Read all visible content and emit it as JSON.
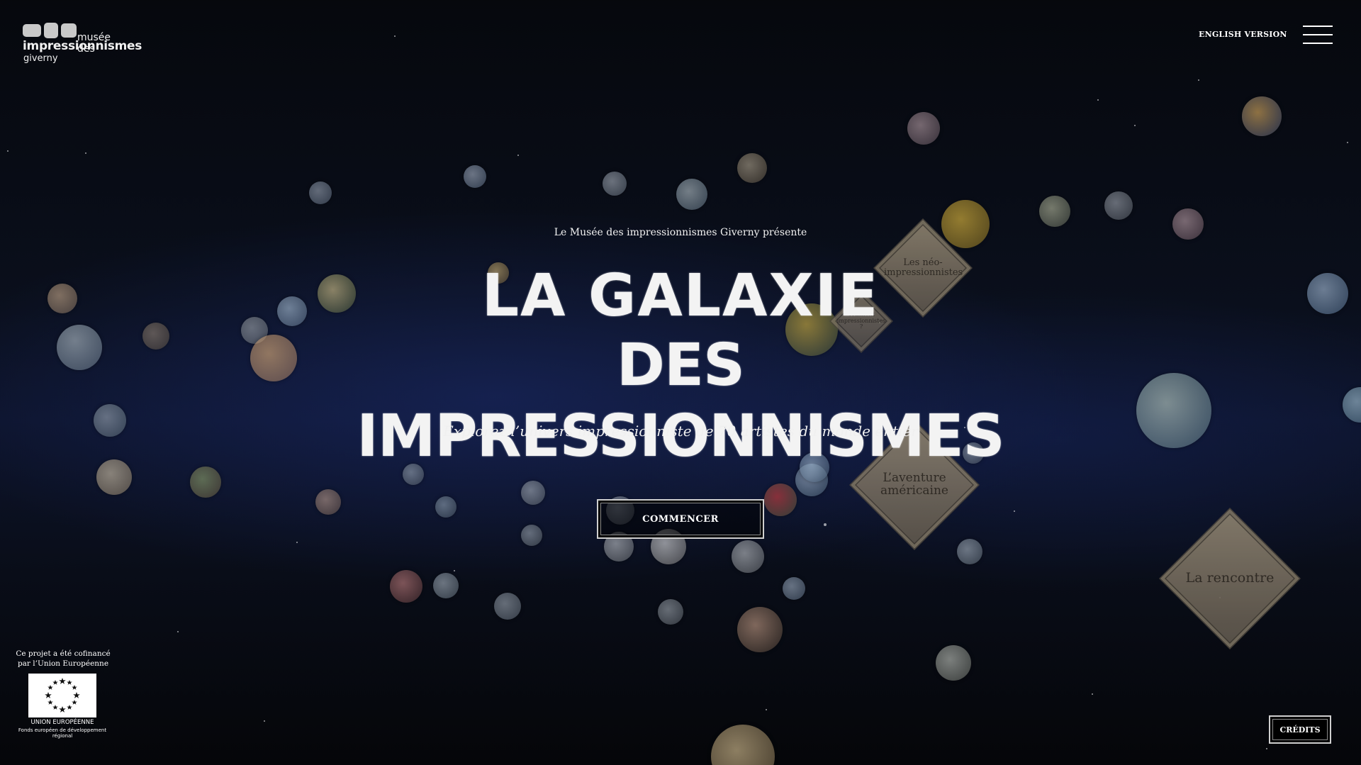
{
  "header": {
    "logo": {
      "line1": "musée des",
      "line2": "impressionnismes",
      "line3": "giverny"
    },
    "language_link": "ENGLISH VERSION",
    "menu_icon": "hamburger-menu-icon"
  },
  "hero": {
    "presents": "Le Musée des impressionnismes Giverny présente",
    "title_line1": "LA GALAXIE",
    "title_line2": "DES IMPRESSIONNISMES",
    "subtitle": "Explorez l’univers impressionniste de 70 artistes du monde entier",
    "start_button": "COMMENCER"
  },
  "constellations": {
    "neo": "Les néo-impressionnistes",
    "vraiment": "Vraiment impressionnistes ?",
    "americaine": "L’aventure américaine",
    "rencontre": "La rencontre"
  },
  "footer": {
    "eu_notice": "Ce projet a été cofinancé par l’Union Européenne",
    "eu_label": "UNION EUROPÉENNE",
    "eu_fund": "Fonds européen de développement régional",
    "credits_button": "CRÉDITS"
  },
  "colors": {
    "background": "#0a0f1c",
    "diamond": "#8f8470",
    "text": "#ffffff"
  }
}
